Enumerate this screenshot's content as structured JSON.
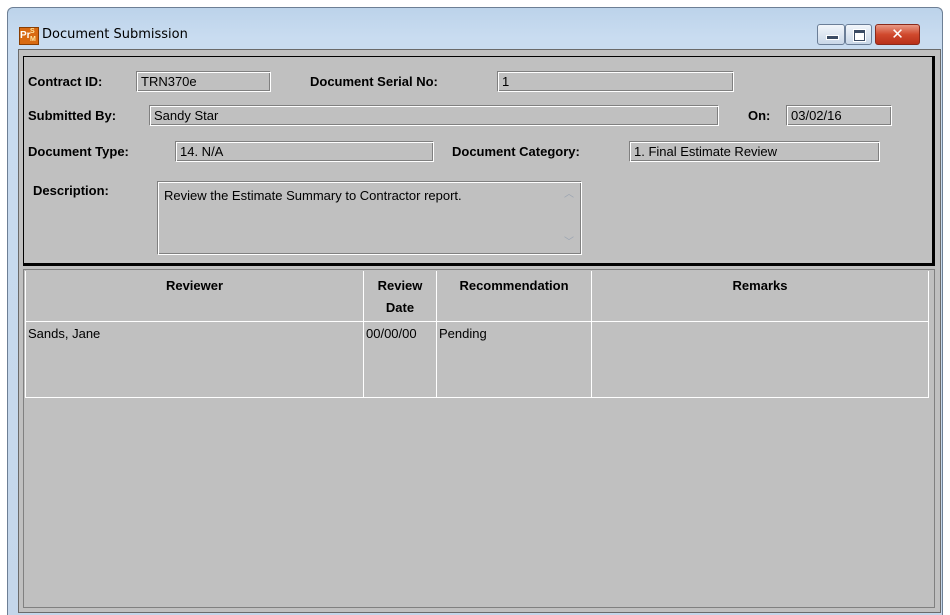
{
  "window": {
    "title": "Document Submission",
    "app_icon": "prism-app-icon",
    "controls": {
      "minimize": "minimize-icon",
      "maximize": "maximize-icon",
      "close": "close-icon",
      "close_glyph": "✕"
    }
  },
  "form": {
    "contract_id": {
      "label": "Contract ID:",
      "value": "TRN370e"
    },
    "document_serial_no": {
      "label": "Document Serial No:",
      "value": "1"
    },
    "submitted_by": {
      "label": "Submitted By:",
      "value": "Sandy Star"
    },
    "on_date": {
      "label": "On:",
      "value": "03/02/16"
    },
    "document_type": {
      "label": "Document Type:",
      "value": "14. N/A"
    },
    "document_category": {
      "label": "Document Category:",
      "value": "1. Final Estimate Review"
    },
    "description": {
      "label": "Description:",
      "value": "Review the Estimate Summary to Contractor report."
    }
  },
  "reviewers_table": {
    "columns": [
      "Reviewer",
      "Review Date",
      "Recommendation",
      "Remarks"
    ],
    "column_lines": {
      "review_date": [
        "Review",
        "Date"
      ]
    },
    "rows": [
      {
        "reviewer": "Sands, Jane",
        "review_date": "00/00/00",
        "recommendation": "Pending",
        "remarks": ""
      }
    ]
  },
  "colors": {
    "panel_background": "#c0c0c0",
    "close_button": "#c8402a",
    "title_bar": "#c9dcf0"
  }
}
